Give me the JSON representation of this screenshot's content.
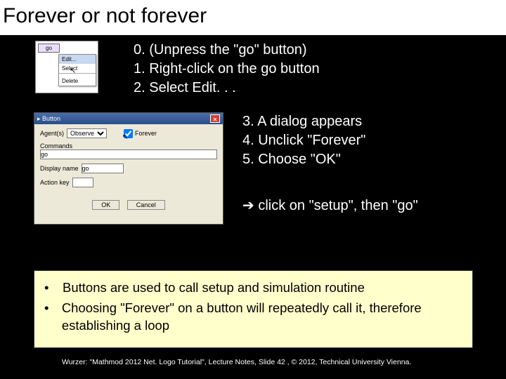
{
  "title": "Forever or not forever",
  "thumb1": {
    "go_label": "go",
    "menu": {
      "edit": "Edit...",
      "select": "Select",
      "divider": "",
      "delete": "Delete"
    }
  },
  "steps_a": {
    "s0": "0.   (Unpress the \"go\" button)",
    "s1": "1.  Right-click on the go button",
    "s2": "2.  Select Edit. . ."
  },
  "dialog": {
    "title": "Button",
    "agents_label": "Agent(s)",
    "agents_value": "Observe",
    "forever_label": "Forever",
    "commands_label": "Commands",
    "commands_value": "go",
    "display_label": "Display name",
    "display_value": "go",
    "action_label": "Action key",
    "ok": "OK",
    "cancel": "Cancel"
  },
  "steps_b": {
    "s3": "3. A dialog appears",
    "s4": "4. Unclick \"Forever\"",
    "s5": "5. Choose \"OK\""
  },
  "arrow_text": " click on \"setup\", then \"go\"",
  "info": {
    "b1": "Buttons are used to call setup and simulation routine",
    "b2": "Choosing \"Forever\" on a button will repeatedly call it, therefore establishing a loop"
  },
  "footer": "Wurzer: \"Mathmod 2012 Net. Logo Tutorial\", Lecture Notes, Slide 42 , © 2012, Technical University Vienna."
}
